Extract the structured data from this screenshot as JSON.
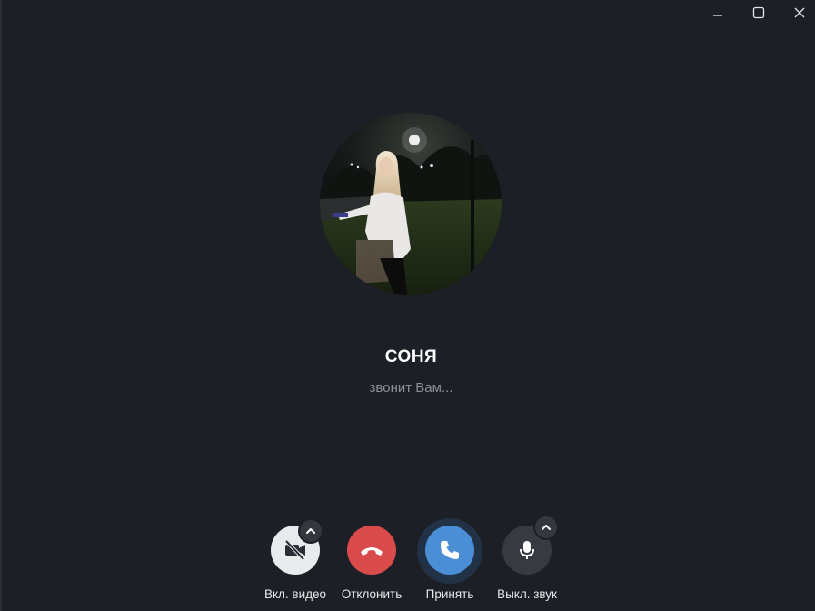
{
  "window": {
    "controls": [
      {
        "name": "minimize",
        "icon": "minimize-icon"
      },
      {
        "name": "maximize",
        "icon": "maximize-icon"
      },
      {
        "name": "close",
        "icon": "close-icon"
      }
    ]
  },
  "caller": {
    "name": "СОНЯ",
    "status": "звонит Вам...",
    "avatar": "caller-photo"
  },
  "controls": {
    "video": {
      "label": "Вкл. видео",
      "icon": "video-off-icon",
      "has_options": true
    },
    "decline": {
      "label": "Отклонить",
      "icon": "hang-up-icon"
    },
    "accept": {
      "label": "Принять",
      "icon": "phone-icon"
    },
    "mute": {
      "label": "Выкл. звук",
      "icon": "microphone-icon",
      "has_options": true
    }
  },
  "colors": {
    "background": "#1c1f25",
    "decline": "#d94b4b",
    "accept": "#4a8ed6",
    "video_button": "#e9eaec",
    "mute_button": "#373a40",
    "status_text": "#8b8f96"
  }
}
